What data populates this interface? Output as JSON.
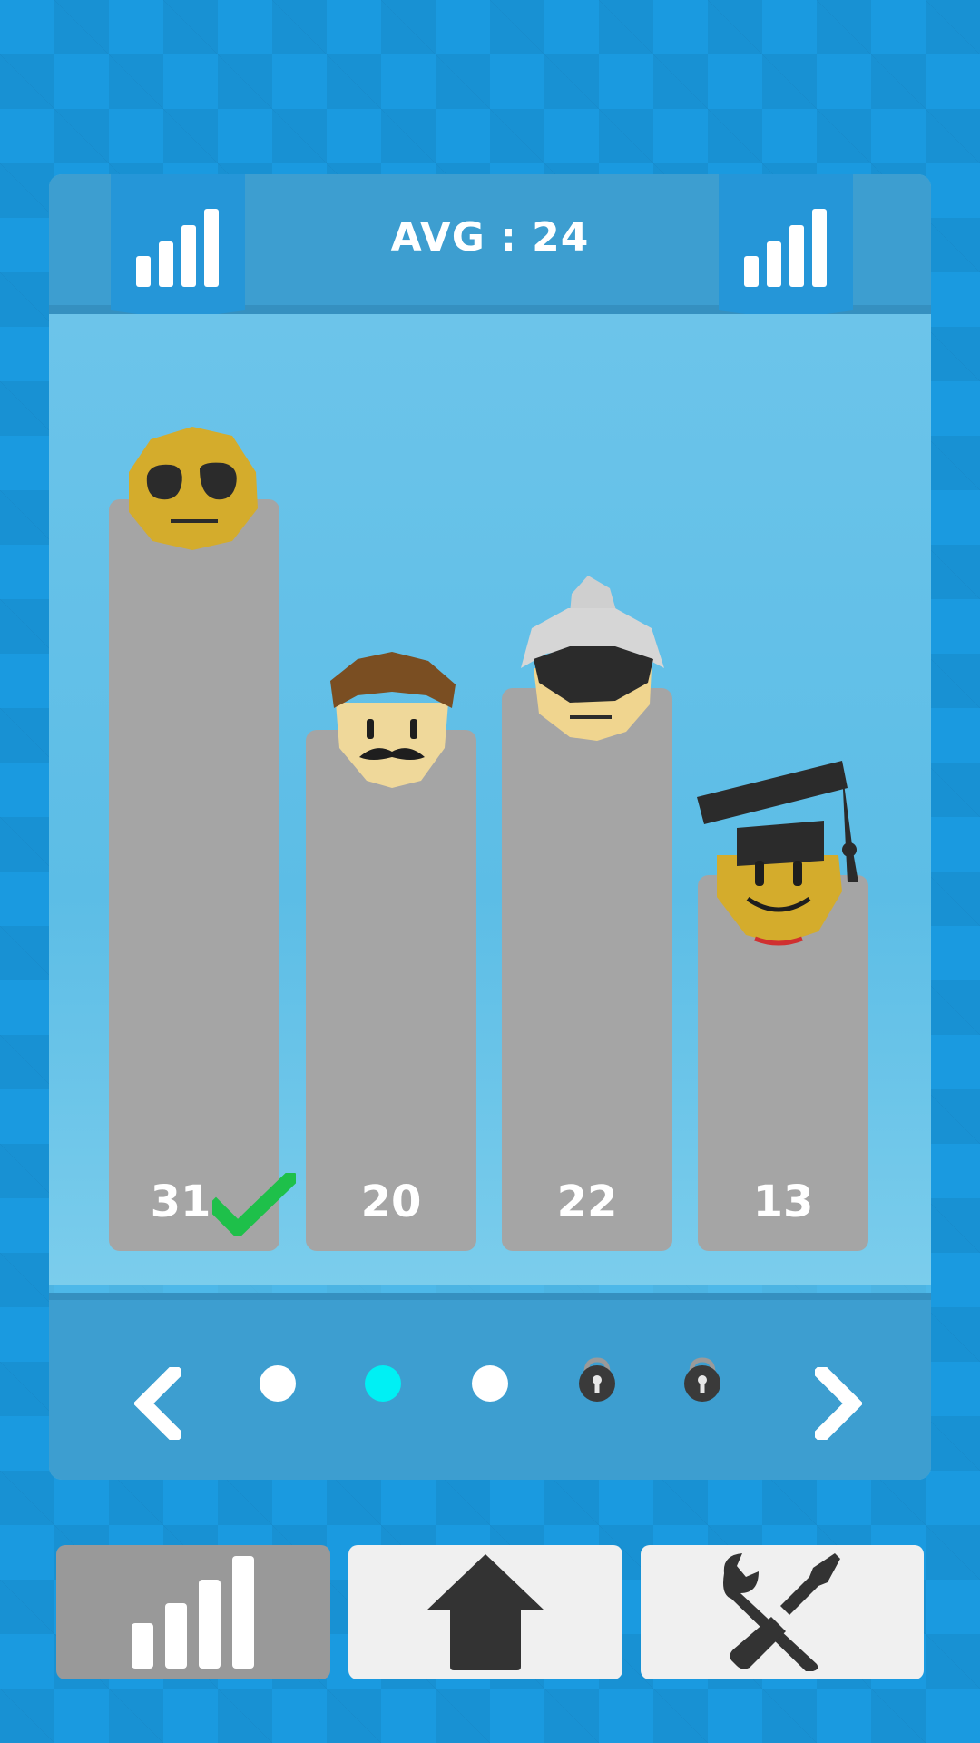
{
  "header": {
    "avg_text": "AVG : 24"
  },
  "characters": [
    {
      "name": "sunglasses-face",
      "value": "31",
      "selected": true
    },
    {
      "name": "mustache-face",
      "value": "20",
      "selected": false
    },
    {
      "name": "beanie-face",
      "value": "22",
      "selected": false
    },
    {
      "name": "graduate-face",
      "value": "13",
      "selected": false
    }
  ],
  "pagination": {
    "pages": 5,
    "current": 2,
    "locked_pages": [
      4,
      5
    ]
  },
  "nav": {
    "items": [
      {
        "name": "stats-tab",
        "icon": "bar-chart-icon",
        "active": true
      },
      {
        "name": "home-tab",
        "icon": "home-icon",
        "active": false
      },
      {
        "name": "tools-tab",
        "icon": "wrench-screwdriver-icon",
        "active": false
      }
    ]
  },
  "colors": {
    "selected_check": "#1ec04a",
    "active_dot": "#00f0f4",
    "bar": "#a5a5a5",
    "header": "#3d9ed0"
  }
}
